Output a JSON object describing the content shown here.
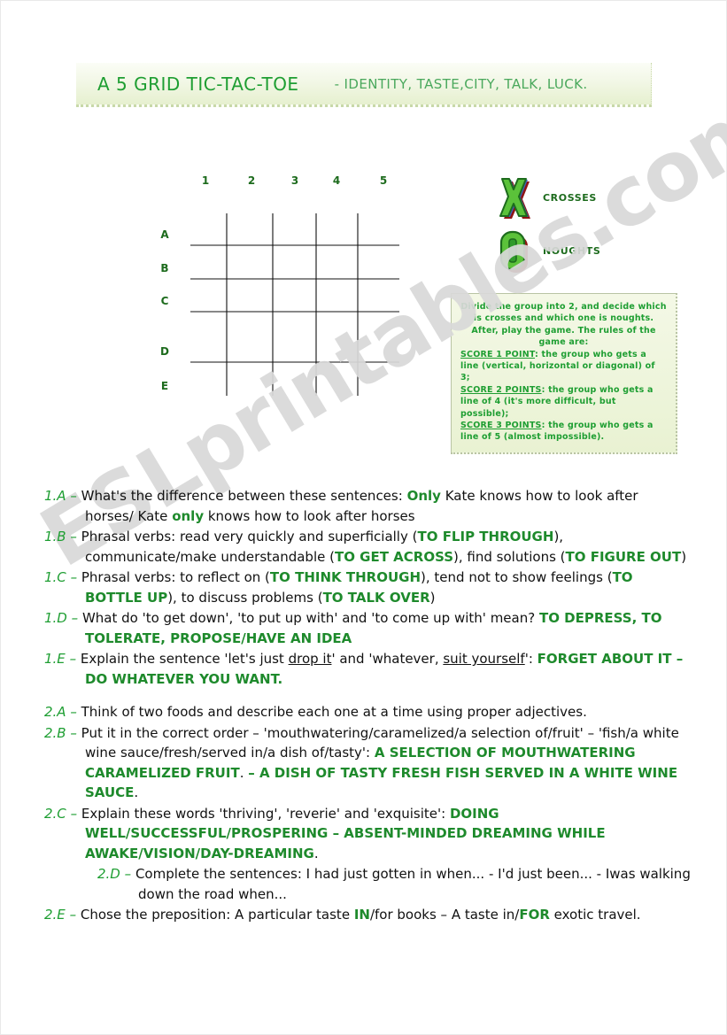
{
  "header": {
    "title": "A 5 GRID TIC-TAC-TOE",
    "subtitle": "-  IDENTITY, TASTE,CITY, TALK, LUCK."
  },
  "watermark": "ESLprintables.com",
  "grid": {
    "columns": [
      "1",
      "2",
      "3",
      "4",
      "5"
    ],
    "rows": [
      "A",
      "B",
      "C",
      "D",
      "E"
    ]
  },
  "legend": {
    "crosses_glyph": "X",
    "crosses_label": "CROSSES",
    "noughts_glyph": "O",
    "noughts_label": "NOUGHTS"
  },
  "rules": {
    "line1": "Divide the group into 2, and decide which",
    "line2": "is crosses and which one is noughts.",
    "line3": "After, play the game. The rules of the",
    "line4": "game are:",
    "score1_label": "SCORE 1 POINT",
    "score1_text": ": the group who gets a line (vertical, horizontal or diagonal) of 3;",
    "score2_label": "SCORE 2 POINTS",
    "score2_text": ": the group who gets a line of 4 (it's more difficult, but possible);",
    "score3_label": "SCORE 3 POINTS",
    "score3_text": ": the group who gets a line of 5 (almost impossible)."
  },
  "questions": {
    "q1a": {
      "label": "1.A",
      "dash": "–",
      "t1": "What's the difference between these sentences: ",
      "a1": "Only",
      "t2": " Kate knows how to look after horses/ Kate ",
      "a2": "only",
      "t3": " knows how to look after horses"
    },
    "q1b": {
      "label": "1.B",
      "dash": "–",
      "t1": "Phrasal verbs: read very quickly and superficially (",
      "a1": "TO FLIP THROUGH",
      "t2": "), communicate/make understandable (",
      "a2": "TO GET ACROSS",
      "t3": "), find solutions (",
      "a3": "TO FIGURE OUT",
      "t4": ")"
    },
    "q1c": {
      "label": "1.C",
      "dash": "–",
      "t1": "Phrasal verbs: to reflect on (",
      "a1": "TO THINK THROUGH",
      "t2": "), tend not to show feelings (",
      "a2": "TO BOTTLE UP",
      "t3": "), to discuss problems (",
      "a3": "TO TALK OVER",
      "t4": ")"
    },
    "q1d": {
      "label": "1.D",
      "dash": "–",
      "t1": "What do 'to get down', 'to put up with' and 'to come up with' mean? ",
      "a1": "TO DEPRESS, TO TOLERATE, PROPOSE/HAVE AN IDEA"
    },
    "q1e": {
      "label": "1.E",
      "dash": "–",
      "t1": "Explain the sentence 'let's just ",
      "u1": "drop it",
      "t2": "' and 'whatever, ",
      "u2": "suit yourself",
      "t3": "': ",
      "a1": "FORGET ABOUT IT – DO WHATEVER YOU WANT",
      "t4": "."
    },
    "q2a": {
      "label": "2.A",
      "dash": "–",
      "t1": "Think of two foods and describe each one at a time using proper adjectives."
    },
    "q2b": {
      "label": "2.B",
      "dash": "–",
      "t1": "Put it in the correct order – 'mouthwatering/caramelized/a selection of/fruit' – 'fish/a white wine sauce/fresh/served in/a dish of/tasty': ",
      "a1": "A SELECTION OF MOUTHWATERING CARAMELIZED FRUIT",
      "t2": ". ",
      "a2": "– A DISH OF TASTY FRESH FISH SERVED IN A WHITE WINE SAUCE",
      "t3": "."
    },
    "q2c": {
      "label": "2.C",
      "dash": "–",
      "t1": "Explain these words 'thriving', 'reverie' and 'exquisite': ",
      "a1": "DOING WELL/SUCCESSFUL/PROSPERING – ABSENT-MINDED DREAMING WHILE AWAKE/VISION/DAY-DREAMING",
      "t2": "."
    },
    "q2d": {
      "label": "2.D",
      "dash": "–",
      "t1": "Complete the sentences: I had just gotten in when... - I'd just been... - Iwas walking down the road when..."
    },
    "q2e": {
      "label": "2.E",
      "dash": "–",
      "t1": "Chose the preposition: A particular taste ",
      "a1": "IN",
      "t2": "/for books – A taste in/",
      "a2": "FOR",
      "t3": " exotic travel."
    }
  },
  "colors": {
    "green_accent": "#1e9e32",
    "dark_green": "#1d6b1d",
    "answer_green": "#1e8a2c",
    "banner_bg": "#eef5dc",
    "rules_bg": "#eef5dc",
    "glyph_green": "#5bc23a",
    "glyph_shadow": "#8f1515"
  }
}
